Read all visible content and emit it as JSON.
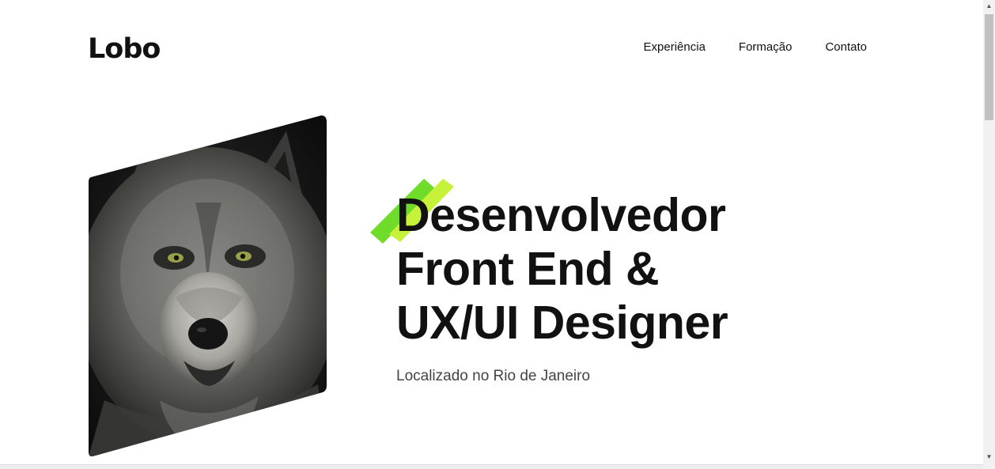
{
  "header": {
    "logo": "Lobo",
    "nav": [
      {
        "label": "Experiência"
      },
      {
        "label": "Formação"
      },
      {
        "label": "Contato"
      }
    ]
  },
  "hero": {
    "headline_lines": [
      "Desenvolvedor",
      "Front End &",
      "UX/UI Designer"
    ],
    "subtitle": "Localizado no Rio de Janeiro",
    "image_icon": "wolf-portrait",
    "accent_colors": [
      "#6fdc2a",
      "#c6f23a"
    ]
  },
  "colors": {
    "text": "#111111",
    "subtitle": "#444444",
    "background": "#ffffff"
  }
}
